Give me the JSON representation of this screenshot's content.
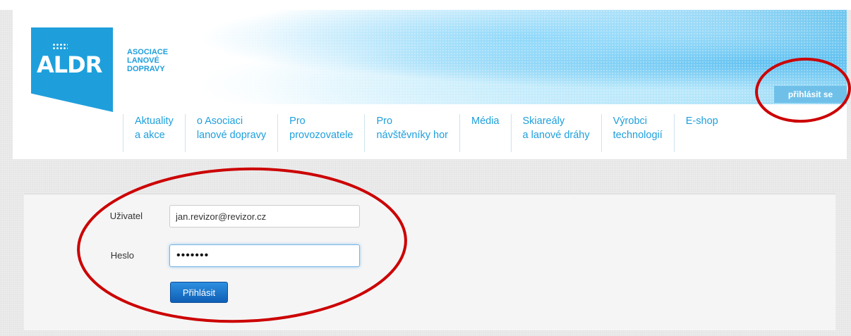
{
  "header": {
    "logo_text": "ALDR",
    "org_name": [
      "ASOCIACE",
      "LANOVÉ",
      "DOPRAVY"
    ],
    "login_link": "přihlásit se"
  },
  "nav": {
    "items": [
      {
        "line1": "Aktuality",
        "line2": "a akce"
      },
      {
        "line1": "o Asociaci",
        "line2": "lanové dopravy"
      },
      {
        "line1": "Pro",
        "line2": "provozovatele"
      },
      {
        "line1": "Pro",
        "line2": "návštěvníky hor"
      },
      {
        "line1": "Média",
        "line2": ""
      },
      {
        "line1": "Skiareály",
        "line2": "a lanové dráhy"
      },
      {
        "line1": "Výrobci",
        "line2": "technologií"
      },
      {
        "line1": "E-shop",
        "line2": ""
      }
    ]
  },
  "login_form": {
    "user_label": "Uživatel",
    "user_value": "jan.revizor@revizor.cz",
    "password_label": "Heslo",
    "password_masked": "•••••••",
    "submit_label": "Přihlásit"
  },
  "colors": {
    "brand_blue": "#1e9fdc",
    "annotation_red": "#cc0000",
    "button_blue": "#0f5fb5"
  }
}
